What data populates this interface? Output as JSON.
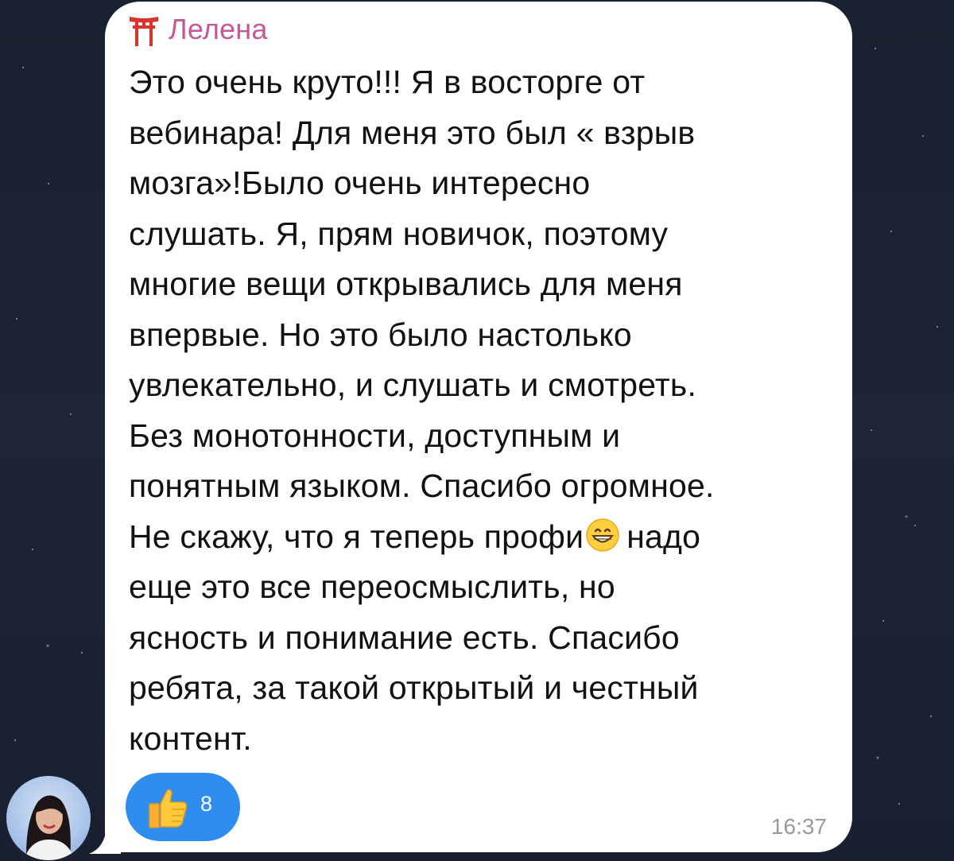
{
  "message": {
    "sender_name": "Лелена",
    "sender_badge_icon": "torii-gate-icon",
    "lines": [
      "Это очень круто!!! Я в восторге от",
      "вебинара! Для меня это был « взрыв",
      "мозга»!Было очень интересно",
      "слушать. Я, прям новичок, поэтому",
      "многие вещи открывались для меня",
      "впервые. Но это было настолько",
      "увлекательно, и слушать и смотреть.",
      "Без монотонности, доступным и",
      "понятным языком. Спасибо огромное."
    ],
    "line_emoji_before": "Не скажу, что я теперь профи",
    "line_emoji_icon": "grinning-face-emoji-icon",
    "line_emoji_after": "надо",
    "lines_after": [
      "еще это все переосмыслить, но",
      "ясность и понимание есть. Спасибо",
      "ребята, за такой открытый и честный",
      "контент."
    ],
    "time": "16:37"
  },
  "reaction": {
    "icon": "thumbs-up-icon",
    "count": "8"
  },
  "colors": {
    "sender_name": "#c25a9a",
    "reaction_bg": "#2f8df0",
    "bubble_bg": "#ffffff",
    "time_text": "#9a9a9e",
    "chat_background": "#1b2232"
  }
}
